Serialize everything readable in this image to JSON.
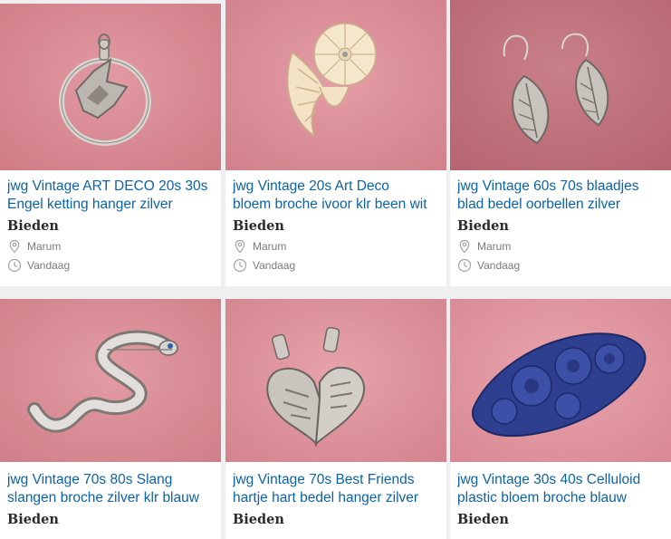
{
  "listings": [
    {
      "title_line1": "jwg Vintage ART DECO 20s 30s",
      "title_line2": "Engel ketting hanger zilver",
      "price": "Bieden",
      "location": "Marum",
      "date": "Vandaag",
      "image": "angel-pendant"
    },
    {
      "title_line1": "jwg Vintage 20s Art Deco",
      "title_line2": "bloem broche ivoor klr been wit",
      "price": "Bieden",
      "location": "Marum",
      "date": "Vandaag",
      "image": "ivory-flower-brooch"
    },
    {
      "title_line1": "jwg Vintage 60s 70s blaadjes",
      "title_line2": "blad bedel oorbellen zilver",
      "price": "Bieden",
      "location": "Marum",
      "date": "Vandaag",
      "image": "leaf-earrings"
    },
    {
      "title_line1": "jwg Vintage 70s 80s Slang",
      "title_line2": "slangen broche zilver klr blauw",
      "price": "Bieden",
      "image": "snake-brooch"
    },
    {
      "title_line1": "jwg Vintage 70s Best Friends",
      "title_line2": "hartje hart bedel hanger zilver",
      "price": "Bieden",
      "image": "heart-pendant"
    },
    {
      "title_line1": "jwg Vintage 30s 40s Celluloid",
      "title_line2": "plastic bloem broche blauw",
      "price": "Bieden",
      "image": "blue-flower-brooch"
    }
  ],
  "colors": {
    "link": "#0b63a6",
    "price": "#2b2b2b",
    "meta": "#7b7b7b",
    "photo_bg": "#d9868f"
  },
  "icons": {
    "location": "map-pin-icon",
    "date": "clock-icon"
  }
}
